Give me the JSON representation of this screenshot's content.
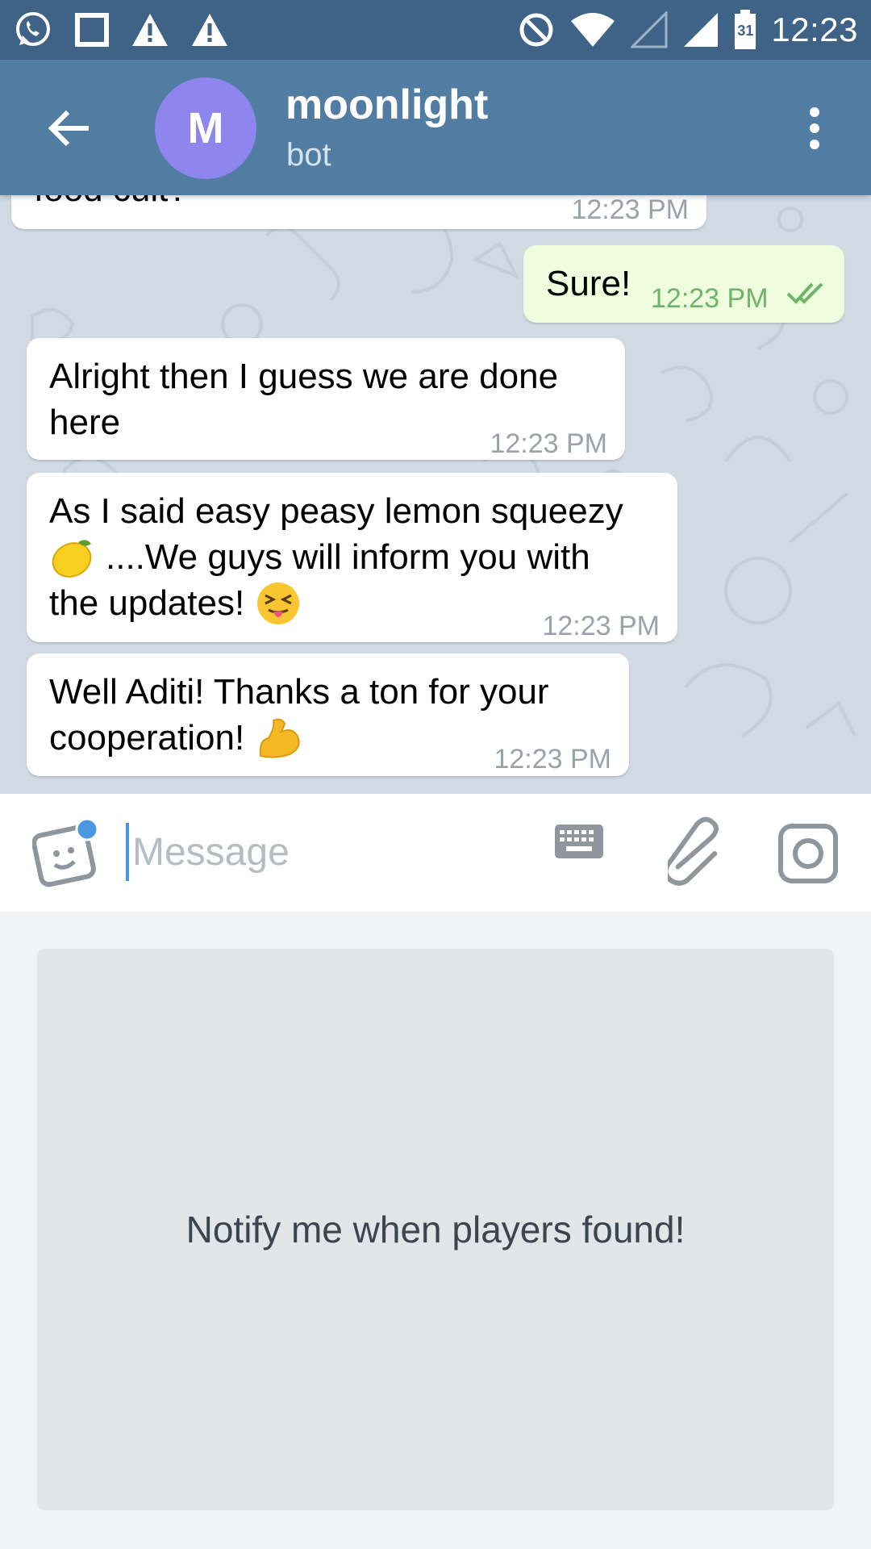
{
  "status_bar": {
    "time": "12:23",
    "calendar_day": "31",
    "left_icons": [
      "whatsapp-icon",
      "square-icon",
      "warning-icon",
      "warning-icon"
    ],
    "right_icons": [
      "do-not-disturb-icon",
      "wifi-icon",
      "signal-empty-icon",
      "signal-icon",
      "battery-icon"
    ]
  },
  "header": {
    "avatar_letter": "M",
    "title": "moonlight",
    "subtitle": "bot",
    "avatar_color": "#8e85ee",
    "bar_color": "#527da3"
  },
  "messages": [
    {
      "direction": "in",
      "text": "food cult?",
      "time": "12:23 PM",
      "partial": true
    },
    {
      "direction": "out",
      "text": "Sure!",
      "time": "12:23 PM",
      "status": "read"
    },
    {
      "direction": "in",
      "lines": [
        "Alright then I guess we are done",
        "here"
      ],
      "time": "12:23 PM"
    },
    {
      "direction": "in",
      "lines": [
        "As I said easy peasy lemon squeezy",
        "....We guys will inform you with",
        "the updates!"
      ],
      "emojis": [
        "lemon",
        "squinting-tongue-face"
      ],
      "time": "12:23 PM"
    },
    {
      "direction": "in",
      "lines": [
        "Well Aditi! Thanks a ton for your",
        "cooperation!"
      ],
      "emojis": [
        "flexed-biceps"
      ],
      "time": "12:23 PM"
    }
  ],
  "input": {
    "placeholder": "Message",
    "value": ""
  },
  "bot_keyboard": {
    "buttons": [
      "Notify me when players found!"
    ]
  }
}
